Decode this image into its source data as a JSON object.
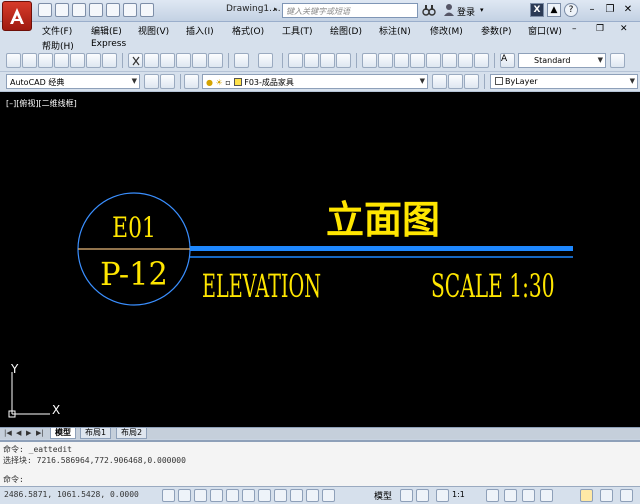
{
  "window": {
    "title": "Drawing1....",
    "search_placeholder": "键入关键字或短语",
    "login_label": "登录"
  },
  "menu": {
    "row1": [
      "文件(F)",
      "编辑(E)",
      "视图(V)",
      "插入(I)",
      "格式(O)",
      "工具(T)",
      "绘图(D)",
      "标注(N)",
      "修改(M)",
      "参数(P)",
      "窗口(W)"
    ],
    "row2": [
      "帮助(H)",
      "Express"
    ]
  },
  "toolbar": {
    "text_style": "Standard",
    "workspace": "AutoCAD 经典",
    "layer": "F03-成品家具",
    "color": "ByLayer"
  },
  "viewport": {
    "label": "[–][俯视][二维线框]"
  },
  "drawing": {
    "circle_top": "E01",
    "circle_bottom": "P-12",
    "title_cn": "立面图",
    "title_en": "ELEVATION",
    "scale": "SCALE 1:30",
    "axis_x": "X",
    "axis_y": "Y",
    "colors": {
      "text": "#ffe600",
      "circle": "#3a8fff",
      "bar": "#1e88ff",
      "divider": "#e8b87a",
      "background": "#000000"
    }
  },
  "tabs": {
    "items": [
      "模型",
      "布局1",
      "布局2"
    ],
    "active": "模型"
  },
  "command": {
    "line1": "命令: _eattedit",
    "line2": "选择块: 7216.586964,772.906468,0.000000",
    "prompt": "命令:"
  },
  "status": {
    "coords": "2486.5871, 1061.5428, 0.0000",
    "model_label": "模型",
    "scale": "1:1"
  }
}
